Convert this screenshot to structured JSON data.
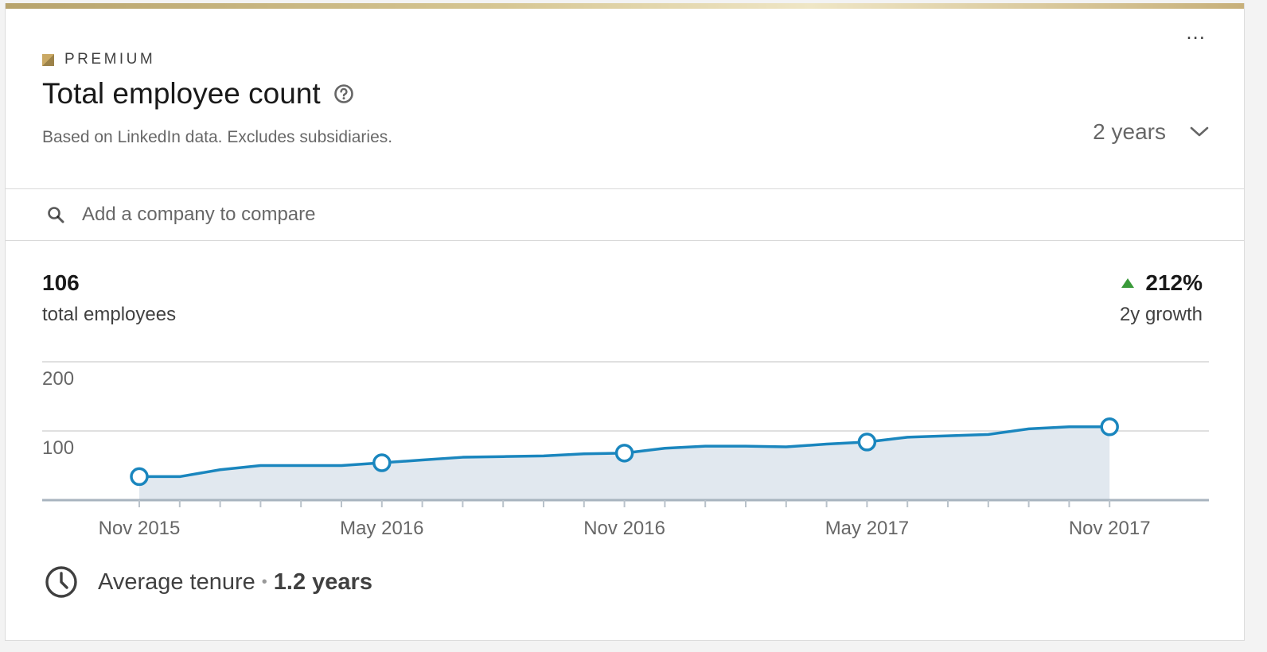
{
  "card": {
    "premium_label": "PREMIUM",
    "more_label": "...",
    "title": "Total employee count",
    "subtitle": "Based on LinkedIn data. Excludes subsidiaries.",
    "range": {
      "value": "2 years"
    },
    "icons": {
      "help": "help-icon",
      "chevron": "chevron-down-icon",
      "search": "search-icon",
      "clock": "clock-icon"
    },
    "colors": {
      "accent": "#1a86be",
      "area": "#e1e8ef",
      "growth": "#3a9a3a",
      "gold": "#c9b27c"
    }
  },
  "search": {
    "placeholder": "Add a company to compare",
    "value": ""
  },
  "stats": {
    "total": "106",
    "total_label": "total employees",
    "growth": "212%",
    "growth_label": "2y growth"
  },
  "tenure": {
    "label": "Average tenure",
    "separator": "•",
    "value": "1.2 years"
  },
  "chart_data": {
    "type": "area",
    "ylim": [
      0,
      200
    ],
    "yticks": [
      100,
      200
    ],
    "grid": true,
    "x_labels": [
      "Nov 2015",
      "May 2016",
      "Nov 2016",
      "May 2017",
      "Nov 2017"
    ],
    "x_label_positions": [
      0,
      6,
      12,
      18,
      24
    ],
    "x": [
      0,
      1,
      2,
      3,
      4,
      5,
      6,
      7,
      8,
      9,
      10,
      11,
      12,
      13,
      14,
      15,
      16,
      17,
      18,
      19,
      20,
      21,
      22,
      23,
      24
    ],
    "values": [
      34,
      34,
      44,
      50,
      50,
      50,
      54,
      58,
      62,
      63,
      64,
      67,
      68,
      75,
      78,
      78,
      77,
      81,
      84,
      91,
      93,
      95,
      103,
      106,
      106
    ],
    "markers": [
      0,
      6,
      12,
      18,
      24
    ]
  }
}
